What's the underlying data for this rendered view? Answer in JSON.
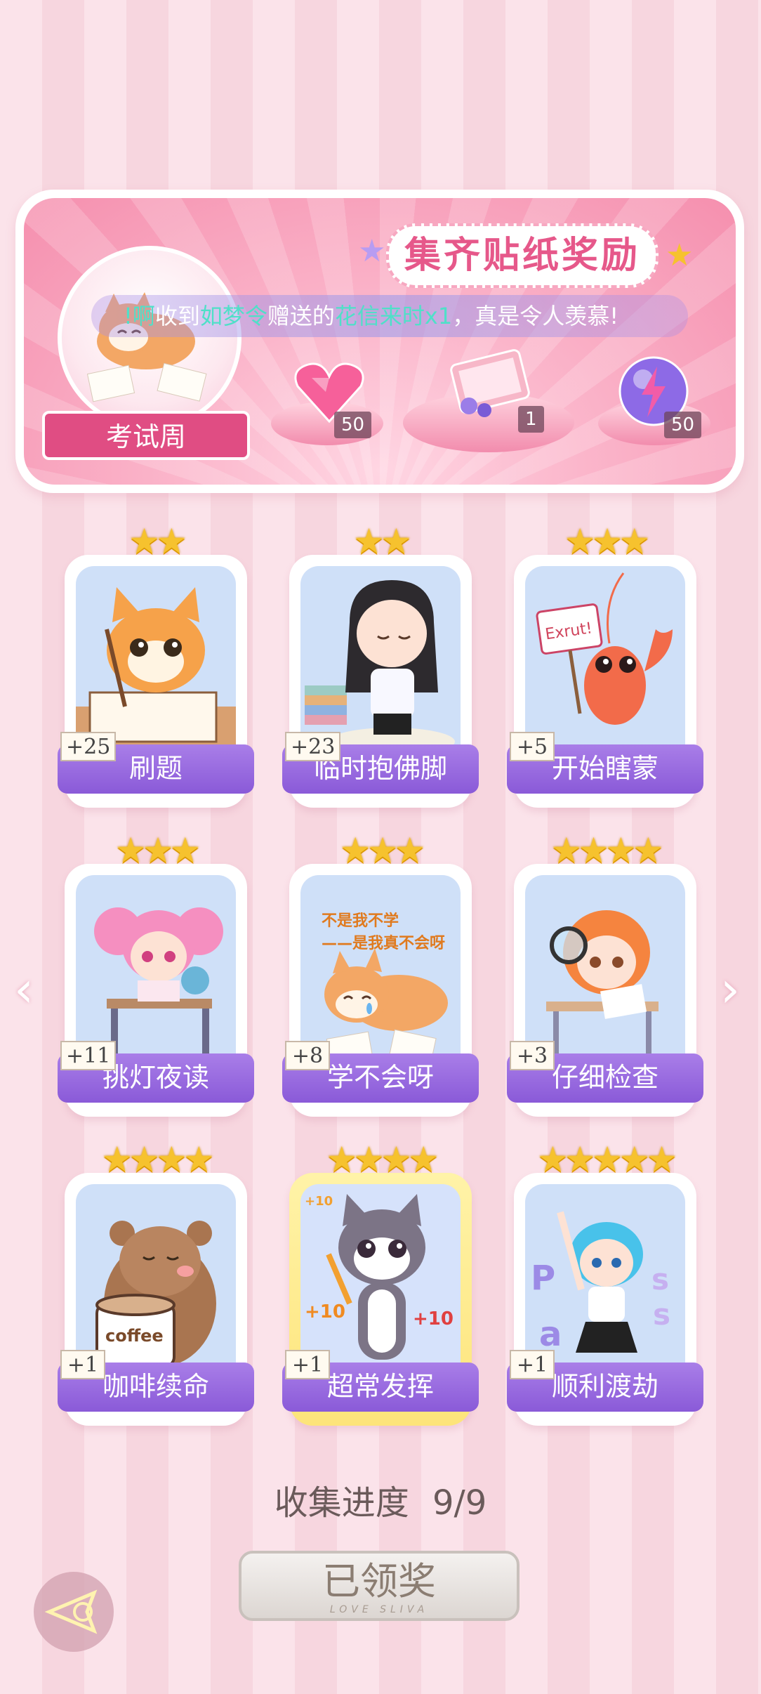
{
  "banner": {
    "title": "集齐贴纸奖励",
    "marquee_prefix": "!啊",
    "marquee_parts": [
      "收到",
      "如梦令",
      "赠送的",
      "花信来时x1",
      "，真是令人羡慕!"
    ],
    "theme_label": "考试周",
    "rewards": [
      {
        "icon": "pink-heart-gem-icon",
        "count": "50"
      },
      {
        "icon": "gift-box-icon",
        "count": "1"
      },
      {
        "icon": "purple-lightning-orb-icon",
        "count": "50"
      }
    ]
  },
  "cards": [
    {
      "stars": "★★",
      "name": "刷题",
      "plus": "+25",
      "art": "cat-writing"
    },
    {
      "stars": "★★",
      "name": "临时抱佛脚",
      "plus": "+23",
      "art": "girl-praying"
    },
    {
      "stars": "★★★",
      "name": "开始瞎蒙",
      "plus": "+5",
      "art": "shrimp-sign",
      "sign_text": "Exrut!"
    },
    {
      "stars": "★★★",
      "name": "挑灯夜读",
      "plus": "+11",
      "art": "girl-desk"
    },
    {
      "stars": "★★★",
      "name": "学不会呀",
      "plus": "+8",
      "art": "shiba-crying",
      "caption": [
        "不是我不学",
        "——是我真不会呀"
      ]
    },
    {
      "stars": "★★★★",
      "name": "仔细检查",
      "plus": "+3",
      "art": "girl-magnifier"
    },
    {
      "stars": "★★★★",
      "name": "咖啡续命",
      "plus": "+1",
      "art": "bear-coffee",
      "cup_text": "coffee"
    },
    {
      "stars": "★★★★",
      "name": "超常发挥",
      "plus": "+1",
      "art": "cat-plus-ten",
      "floats": [
        "+10",
        "+10",
        "+10"
      ]
    },
    {
      "stars": "★★★★★",
      "name": "顺利渡劫",
      "plus": "+1",
      "art": "girl-pass",
      "letters": [
        "P",
        "a",
        "s",
        "s"
      ]
    }
  ],
  "progress": {
    "label": "收集进度",
    "value": "9/9"
  },
  "claim_button": {
    "label": "已领奖",
    "sub": "LOVE SLIVA"
  },
  "colors": {
    "accent_pink": "#e04d83",
    "card_purple": "#8a5ad8",
    "star_gold": "#f6c22e"
  }
}
